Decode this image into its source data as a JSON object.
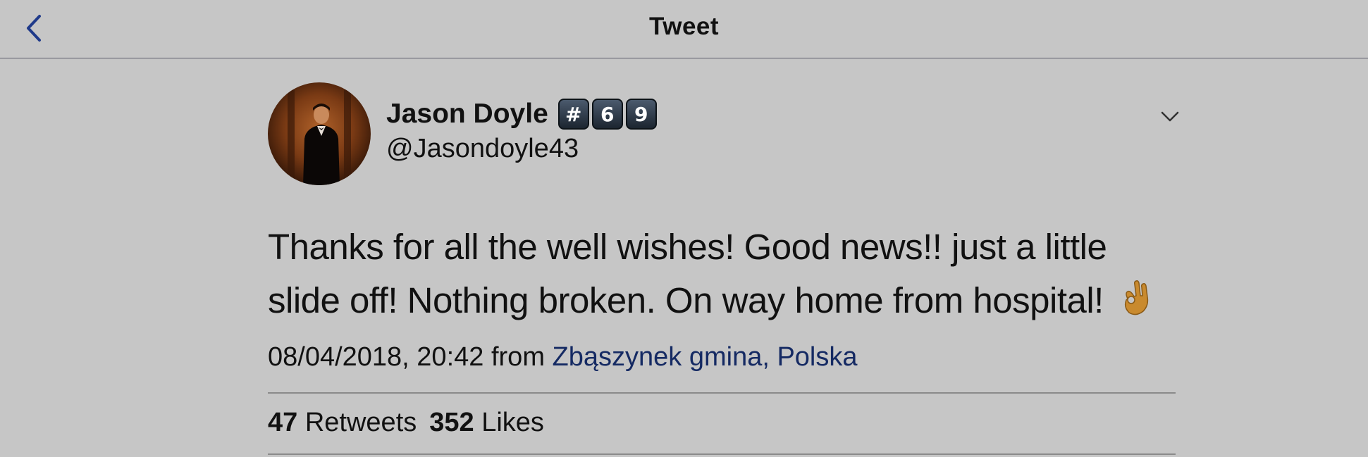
{
  "nav": {
    "title": "Tweet",
    "back_icon": "chevron-left-icon"
  },
  "tweet": {
    "author": {
      "display_name": "Jason Doyle",
      "badges": [
        "#",
        "6",
        "9"
      ],
      "handle": "@Jasondoyle43"
    },
    "text": "Thanks for all the well wishes! Good news!!  just a little slide off! Nothing broken. On way home from hospital!",
    "emoji": "ok-hand-emoji",
    "timestamp": "08/04/2018, 20:42",
    "from_label": "from",
    "location": "Zbąszynek gmina, Polska",
    "retweets_count": "47",
    "retweets_label": "Retweets",
    "likes_count": "352",
    "likes_label": "Likes"
  },
  "colors": {
    "background": "#c6c6c6",
    "link": "#152a63",
    "back_icon": "#1f3a8a"
  }
}
